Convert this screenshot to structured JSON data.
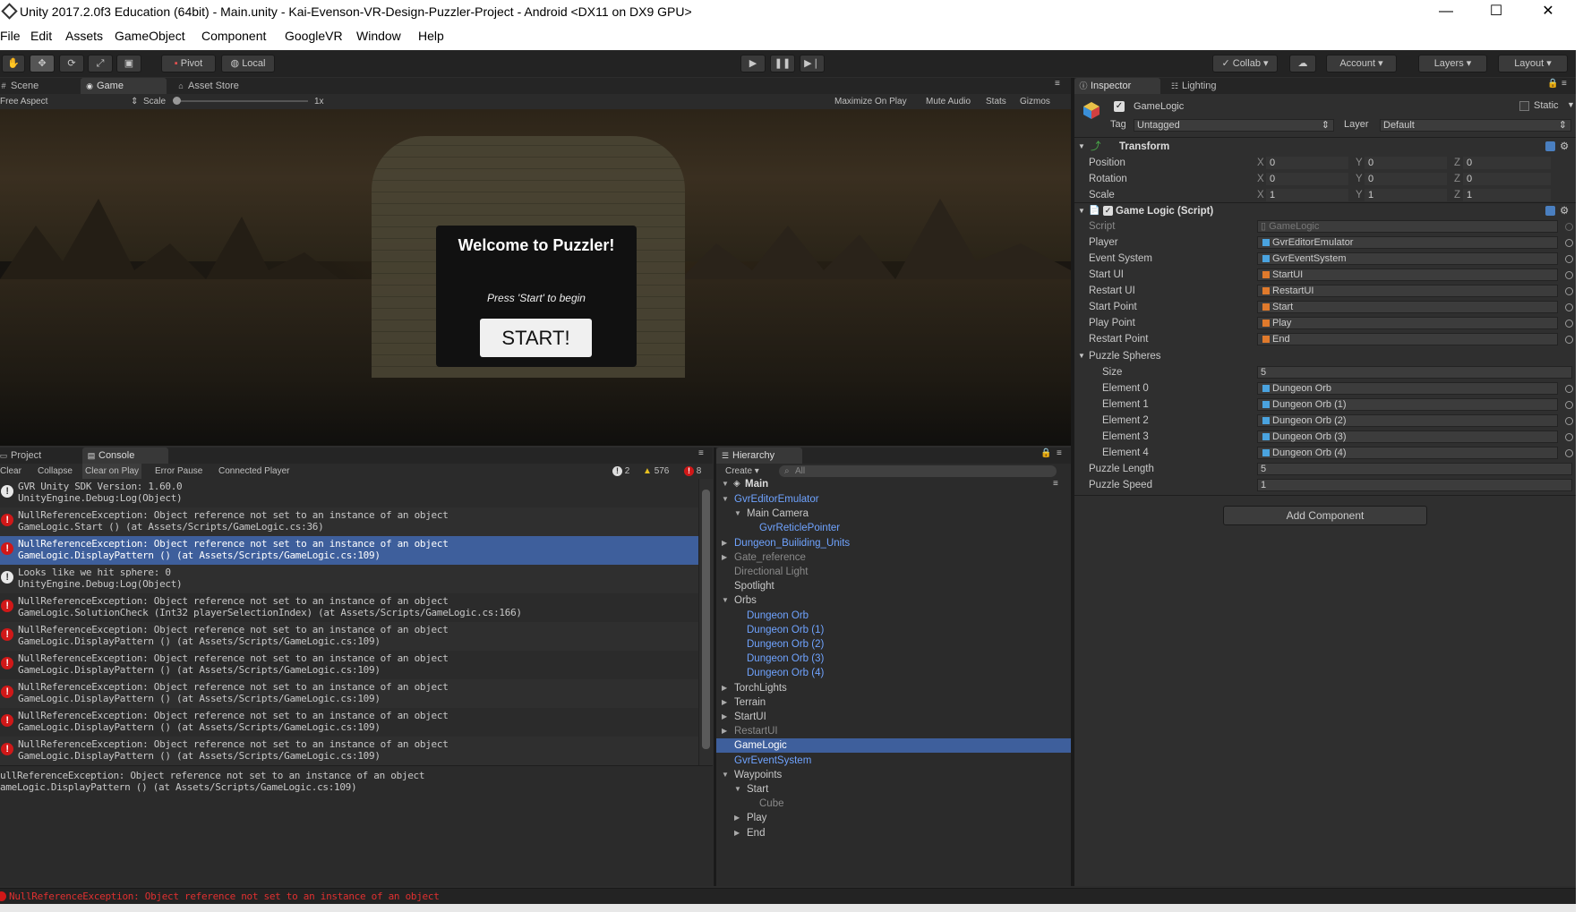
{
  "window": {
    "title": "Unity 2017.2.0f3 Education (64bit) - Main.unity - Kai-Evenson-VR-Design-Puzzler-Project - Android <DX11 on DX9 GPU>",
    "controls": {
      "minimize": "—",
      "maximize": "☐",
      "close": "✕"
    }
  },
  "menu": [
    "File",
    "Edit",
    "Assets",
    "GameObject",
    "Component",
    "GoogleVR",
    "Window",
    "Help"
  ],
  "toolbar": {
    "pivot": "Pivot",
    "local": "Local",
    "collab": "Collab",
    "account": "Account",
    "layers": "Layers",
    "layout": "Layout"
  },
  "scene_tabs": {
    "scene": "Scene",
    "game": "Game",
    "asset_store": "Asset Store"
  },
  "game_bar": {
    "aspect": "Free Aspect",
    "scale_label": "Scale",
    "scale_value": "1x",
    "maximize": "Maximize On Play",
    "mute": "Mute Audio",
    "stats": "Stats",
    "gizmos": "Gizmos"
  },
  "game_ui": {
    "welcome": "Welcome to Puzzler!",
    "press": "Press 'Start' to begin",
    "start_button": "START!"
  },
  "console": {
    "tabs": {
      "project": "Project",
      "console": "Console"
    },
    "buttons": {
      "clear": "Clear",
      "collapse": "Collapse",
      "clear_on_play": "Clear on Play",
      "error_pause": "Error Pause",
      "connected": "Connected Player"
    },
    "counts": {
      "info": "2",
      "warn": "576",
      "error": "8"
    },
    "logs": [
      {
        "type": "info",
        "l1": "GVR Unity SDK Version: 1.60.0",
        "l2": "UnityEngine.Debug:Log(Object)"
      },
      {
        "type": "err",
        "l1": "NullReferenceException: Object reference not set to an instance of an object",
        "l2": "GameLogic.Start () (at Assets/Scripts/GameLogic.cs:36)"
      },
      {
        "type": "err",
        "l1": "NullReferenceException: Object reference not set to an instance of an object",
        "l2": "GameLogic.DisplayPattern () (at Assets/Scripts/GameLogic.cs:109)"
      },
      {
        "type": "info",
        "l1": "Looks like we hit sphere: 0",
        "l2": "UnityEngine.Debug:Log(Object)"
      },
      {
        "type": "err",
        "l1": "NullReferenceException: Object reference not set to an instance of an object",
        "l2": "GameLogic.SolutionCheck (Int32 playerSelectionIndex) (at Assets/Scripts/GameLogic.cs:166)"
      },
      {
        "type": "err",
        "l1": "NullReferenceException: Object reference not set to an instance of an object",
        "l2": "GameLogic.DisplayPattern () (at Assets/Scripts/GameLogic.cs:109)"
      },
      {
        "type": "err",
        "l1": "NullReferenceException: Object reference not set to an instance of an object",
        "l2": "GameLogic.DisplayPattern () (at Assets/Scripts/GameLogic.cs:109)"
      },
      {
        "type": "err",
        "l1": "NullReferenceException: Object reference not set to an instance of an object",
        "l2": "GameLogic.DisplayPattern () (at Assets/Scripts/GameLogic.cs:109)"
      },
      {
        "type": "err",
        "l1": "NullReferenceException: Object reference not set to an instance of an object",
        "l2": "GameLogic.DisplayPattern () (at Assets/Scripts/GameLogic.cs:109)"
      },
      {
        "type": "err",
        "l1": "NullReferenceException: Object reference not set to an instance of an object",
        "l2": "GameLogic.DisplayPattern () (at Assets/Scripts/GameLogic.cs:109)"
      }
    ],
    "detail_l1": "ullReferenceException: Object reference not set to an instance of an object",
    "detail_l2": "ameLogic.DisplayPattern () (at Assets/Scripts/GameLogic.cs:109)"
  },
  "status_bar": "NullReferenceException: Object reference not set to an instance of an object",
  "hierarchy": {
    "tab": "Hierarchy",
    "create": "Create",
    "search_placeholder": "All",
    "scene": "Main",
    "items": [
      "GvrEditorEmulator",
      "Main Camera",
      "GvrReticlePointer",
      "Dungeon_Builiding_Units",
      "Gate_reference",
      "Directional Light",
      "Spotlight",
      "Orbs",
      "Dungeon Orb",
      "Dungeon Orb (1)",
      "Dungeon Orb (2)",
      "Dungeon Orb (3)",
      "Dungeon Orb (4)",
      "TorchLights",
      "Terrain",
      "StartUI",
      "RestartUI",
      "GameLogic",
      "GvrEventSystem",
      "Waypoints",
      "Start",
      "Cube",
      "Play",
      "End"
    ]
  },
  "inspector": {
    "tabs": {
      "inspector": "Inspector",
      "lighting": "Lighting"
    },
    "object_name": "GameLogic",
    "static": "Static",
    "tag_label": "Tag",
    "tag_value": "Untagged",
    "layer_label": "Layer",
    "layer_value": "Default",
    "transform": {
      "title": "Transform",
      "rows": [
        {
          "label": "Position",
          "x": "0",
          "y": "0",
          "z": "0"
        },
        {
          "label": "Rotation",
          "x": "0",
          "y": "0",
          "z": "0"
        },
        {
          "label": "Scale",
          "x": "1",
          "y": "1",
          "z": "1"
        }
      ],
      "axes": {
        "x": "X",
        "y": "Y",
        "z": "Z"
      }
    },
    "script_component": {
      "title": "Game Logic (Script)",
      "script_label": "Script",
      "script_value": "GameLogic",
      "refs": [
        {
          "label": "Player",
          "value": "GvrEditorEmulator"
        },
        {
          "label": "Event System",
          "value": "GvrEventSystem"
        },
        {
          "label": "Start UI",
          "value": "StartUI"
        },
        {
          "label": "Restart UI",
          "value": "RestartUI"
        },
        {
          "label": "Start Point",
          "value": "Start"
        },
        {
          "label": "Play Point",
          "value": "Play"
        },
        {
          "label": "Restart Point",
          "value": "End"
        }
      ],
      "puzzle_spheres": "Puzzle Spheres",
      "size_label": "Size",
      "size_value": "5",
      "elements": [
        {
          "label": "Element 0",
          "value": "Dungeon Orb"
        },
        {
          "label": "Element 1",
          "value": "Dungeon Orb (1)"
        },
        {
          "label": "Element 2",
          "value": "Dungeon Orb (2)"
        },
        {
          "label": "Element 3",
          "value": "Dungeon Orb (3)"
        },
        {
          "label": "Element 4",
          "value": "Dungeon Orb (4)"
        }
      ],
      "puzzle_length_label": "Puzzle Length",
      "puzzle_length_value": "5",
      "puzzle_speed_label": "Puzzle Speed",
      "puzzle_speed_value": "1"
    },
    "add_component": "Add Component"
  }
}
